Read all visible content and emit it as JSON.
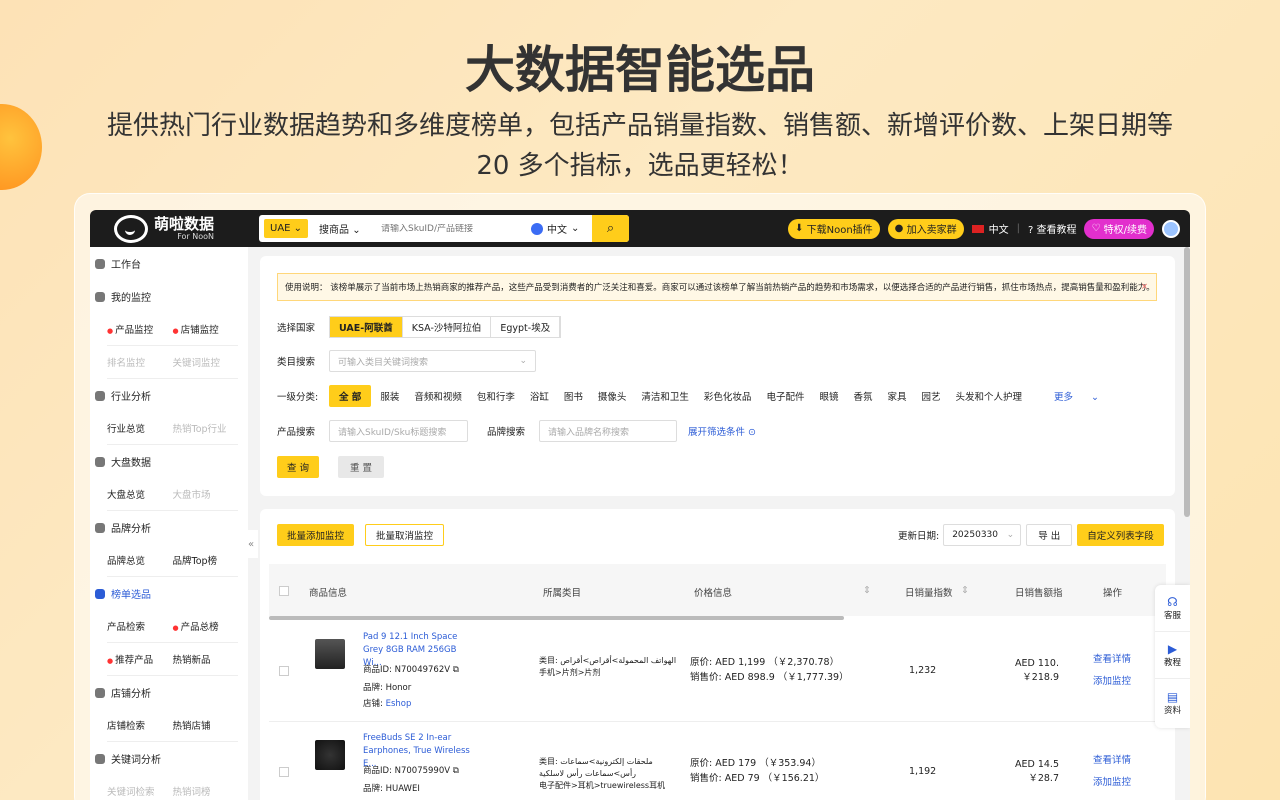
{
  "hero": {
    "title": "大数据智能选品",
    "subtitle": "提供热门行业数据趋势和多维度榜单，包括产品销量指数、销售额、新增评价数、上架日期等 20 多个指标，选品更轻松！"
  },
  "brand": {
    "name": "萌啦数据",
    "sub": "For NooN"
  },
  "search": {
    "country": "UAE",
    "type": "搜商品",
    "placeholder": "请输入SkuID/产品链接",
    "lang": "中文",
    "button_icon": "search-icon"
  },
  "topbar": {
    "download": "下载Noon插件",
    "group": "加入卖家群",
    "lang": "中文",
    "tutorial": "查看教程",
    "vip": "特权/续费"
  },
  "sidebar": {
    "workbench": "工作台",
    "monitor": {
      "title": "我的监控",
      "items": [
        "产品监控",
        "店铺监控",
        "排名监控",
        "关键词监控"
      ]
    },
    "industry": {
      "title": "行业分析",
      "items": [
        "行业总览",
        "热销Top行业"
      ]
    },
    "market": {
      "title": "大盘数据",
      "items": [
        "大盘总览",
        "大盘市场"
      ]
    },
    "brand": {
      "title": "品牌分析",
      "items": [
        "品牌总览",
        "品牌Top榜"
      ]
    },
    "rank": {
      "title": "榜单选品",
      "items": [
        "产品检索",
        "产品总榜",
        "推荐产品",
        "热销新品"
      ]
    },
    "shop": {
      "title": "店铺分析",
      "items": [
        "店铺检索",
        "热销店铺"
      ]
    },
    "keyword": {
      "title": "关键词分析",
      "items": [
        "关键词检索",
        "热销词榜"
      ]
    }
  },
  "notice": {
    "text": "使用说明： 该榜单展示了当前市场上热销商家的推荐产品，这些产品受到消费者的广泛关注和喜爱。商家可以通过该榜单了解当前热销产品的趋势和市场需求，以便选择合适的产品进行销售，抓住市场热点，提高销售量和盈利能力。",
    "close": "×"
  },
  "filters": {
    "country_label": "选择国家",
    "countries": [
      "UAE-阿联酋",
      "KSA-沙特阿拉伯",
      "Egypt-埃及"
    ],
    "category_label": "类目搜索",
    "category_placeholder": "可输入类目关键词搜索",
    "level1_label": "一级分类:",
    "level1": [
      "全 部",
      "服装",
      "音频和视频",
      "包和行李",
      "浴缸",
      "图书",
      "摄像头",
      "清洁和卫生",
      "彩色化妆品",
      "电子配件",
      "眼镜",
      "香氛",
      "家具",
      "园艺",
      "头发和个人护理"
    ],
    "more": "更多",
    "product_label": "产品搜索",
    "product_placeholder": "请输入SkuID/Sku标题搜索",
    "brand_label": "品牌搜索",
    "brand_placeholder": "请输入品牌名称搜索",
    "expand": "展开筛选条件",
    "query": "查 询",
    "reset": "重 置"
  },
  "toolbar": {
    "batch_add": "批量添加监控",
    "batch_cancel": "批量取消监控",
    "date_label": "更新日期:",
    "date": "20250330",
    "export": "导 出",
    "custom": "自定义列表字段"
  },
  "table": {
    "headers": [
      "商品信息",
      "所属类目",
      "价格信息",
      "日销量指数",
      "日销售额指",
      "操作"
    ],
    "rows": [
      {
        "name": "Pad 9 12.1 Inch Space Grey 8GB RAM 256GB Wi...",
        "id_label": "商品ID:",
        "id": "N70049762V",
        "brand_label": "品牌:",
        "brand": "Honor",
        "shop_label": "店铺:",
        "shop": "Eshop",
        "cat_label": "类目:",
        "cat_ar": "الهواتف المحمولة>أقراص>أقراص",
        "cat_zh": "手机>片剂>片剂",
        "orig_label": "原价:",
        "orig": "AED 1,199 （￥2,370.78）",
        "sale_label": "销售价:",
        "sale": "AED 898.9 （￥1,777.39）",
        "index": "1,232",
        "rev1": "AED 110.",
        "rev2": "￥218.9",
        "op1": "查看详情",
        "op2": "添加监控"
      },
      {
        "name": "FreeBuds SE 2 In-ear Earphones, True Wireless E...",
        "id_label": "商品ID:",
        "id": "N70075990V",
        "brand_label": "品牌:",
        "brand": "HUAWEI",
        "cat_label": "类目:",
        "cat_ar": "ملحقات إلكترونية>سماعات رأس>سماعات رأس لاسلكية",
        "cat_zh": "电子配件>耳机>truewireless耳机",
        "orig_label": "原价:",
        "orig": "AED 179 （￥353.94）",
        "sale_label": "销售价:",
        "sale": "AED 79 （￥156.21）",
        "index": "1,192",
        "rev1": "AED 14.5",
        "rev2": "￥28.7",
        "op1": "查看详情",
        "op2": "添加监控"
      }
    ]
  },
  "float": {
    "service": "客服",
    "tutorial": "教程",
    "docs": "资料"
  }
}
